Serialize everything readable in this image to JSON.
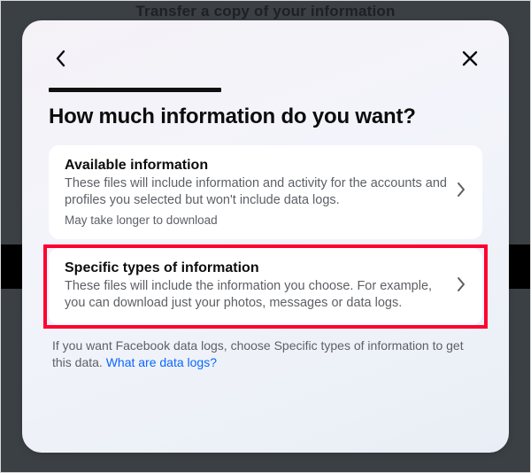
{
  "backdrop": {
    "peek_title": "Transfer a copy of your information"
  },
  "modal": {
    "title": "How much information do you want?",
    "options": [
      {
        "title": "Available information",
        "desc": "These files will include information and activity for the accounts and profiles you selected but won't include data logs.",
        "meta": "May take longer to download"
      },
      {
        "title": "Specific types of information",
        "desc": "These files will include the information you choose. For example, you can download just your photos, messages or data logs."
      }
    ],
    "footer": {
      "text_before_link": "If you want Facebook data logs, choose Specific types of information to get this data. ",
      "link_text": "What are data logs?"
    }
  }
}
